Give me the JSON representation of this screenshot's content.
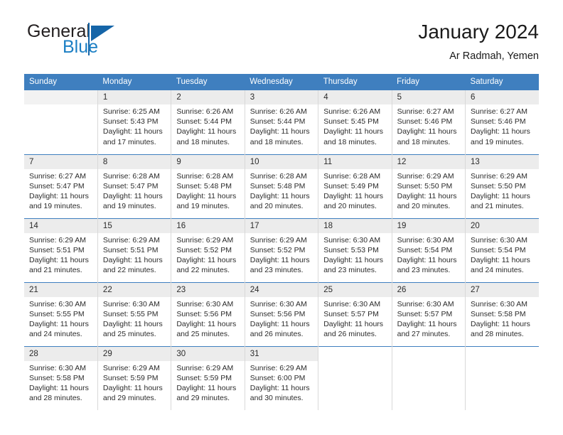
{
  "brand": {
    "name_part1": "General",
    "name_part2": "Blue",
    "logo_icon": "triangle-flag-icon"
  },
  "header": {
    "title": "January 2024",
    "location": "Ar Radmah, Yemen"
  },
  "calendar": {
    "weekday_headers": [
      "Sunday",
      "Monday",
      "Tuesday",
      "Wednesday",
      "Thursday",
      "Friday",
      "Saturday"
    ],
    "accent_color": "#3f7fbf",
    "daynum_bg": "#ececec",
    "weeks": [
      [
        {
          "day": "",
          "sunrise": "",
          "sunset": "",
          "daylight": "",
          "empty": true
        },
        {
          "day": "1",
          "sunrise": "Sunrise: 6:25 AM",
          "sunset": "Sunset: 5:43 PM",
          "daylight": "Daylight: 11 hours and 17 minutes."
        },
        {
          "day": "2",
          "sunrise": "Sunrise: 6:26 AM",
          "sunset": "Sunset: 5:44 PM",
          "daylight": "Daylight: 11 hours and 18 minutes."
        },
        {
          "day": "3",
          "sunrise": "Sunrise: 6:26 AM",
          "sunset": "Sunset: 5:44 PM",
          "daylight": "Daylight: 11 hours and 18 minutes."
        },
        {
          "day": "4",
          "sunrise": "Sunrise: 6:26 AM",
          "sunset": "Sunset: 5:45 PM",
          "daylight": "Daylight: 11 hours and 18 minutes."
        },
        {
          "day": "5",
          "sunrise": "Sunrise: 6:27 AM",
          "sunset": "Sunset: 5:46 PM",
          "daylight": "Daylight: 11 hours and 18 minutes."
        },
        {
          "day": "6",
          "sunrise": "Sunrise: 6:27 AM",
          "sunset": "Sunset: 5:46 PM",
          "daylight": "Daylight: 11 hours and 19 minutes."
        }
      ],
      [
        {
          "day": "7",
          "sunrise": "Sunrise: 6:27 AM",
          "sunset": "Sunset: 5:47 PM",
          "daylight": "Daylight: 11 hours and 19 minutes."
        },
        {
          "day": "8",
          "sunrise": "Sunrise: 6:28 AM",
          "sunset": "Sunset: 5:47 PM",
          "daylight": "Daylight: 11 hours and 19 minutes."
        },
        {
          "day": "9",
          "sunrise": "Sunrise: 6:28 AM",
          "sunset": "Sunset: 5:48 PM",
          "daylight": "Daylight: 11 hours and 19 minutes."
        },
        {
          "day": "10",
          "sunrise": "Sunrise: 6:28 AM",
          "sunset": "Sunset: 5:48 PM",
          "daylight": "Daylight: 11 hours and 20 minutes."
        },
        {
          "day": "11",
          "sunrise": "Sunrise: 6:28 AM",
          "sunset": "Sunset: 5:49 PM",
          "daylight": "Daylight: 11 hours and 20 minutes."
        },
        {
          "day": "12",
          "sunrise": "Sunrise: 6:29 AM",
          "sunset": "Sunset: 5:50 PM",
          "daylight": "Daylight: 11 hours and 20 minutes."
        },
        {
          "day": "13",
          "sunrise": "Sunrise: 6:29 AM",
          "sunset": "Sunset: 5:50 PM",
          "daylight": "Daylight: 11 hours and 21 minutes."
        }
      ],
      [
        {
          "day": "14",
          "sunrise": "Sunrise: 6:29 AM",
          "sunset": "Sunset: 5:51 PM",
          "daylight": "Daylight: 11 hours and 21 minutes."
        },
        {
          "day": "15",
          "sunrise": "Sunrise: 6:29 AM",
          "sunset": "Sunset: 5:51 PM",
          "daylight": "Daylight: 11 hours and 22 minutes."
        },
        {
          "day": "16",
          "sunrise": "Sunrise: 6:29 AM",
          "sunset": "Sunset: 5:52 PM",
          "daylight": "Daylight: 11 hours and 22 minutes."
        },
        {
          "day": "17",
          "sunrise": "Sunrise: 6:29 AM",
          "sunset": "Sunset: 5:52 PM",
          "daylight": "Daylight: 11 hours and 23 minutes."
        },
        {
          "day": "18",
          "sunrise": "Sunrise: 6:30 AM",
          "sunset": "Sunset: 5:53 PM",
          "daylight": "Daylight: 11 hours and 23 minutes."
        },
        {
          "day": "19",
          "sunrise": "Sunrise: 6:30 AM",
          "sunset": "Sunset: 5:54 PM",
          "daylight": "Daylight: 11 hours and 23 minutes."
        },
        {
          "day": "20",
          "sunrise": "Sunrise: 6:30 AM",
          "sunset": "Sunset: 5:54 PM",
          "daylight": "Daylight: 11 hours and 24 minutes."
        }
      ],
      [
        {
          "day": "21",
          "sunrise": "Sunrise: 6:30 AM",
          "sunset": "Sunset: 5:55 PM",
          "daylight": "Daylight: 11 hours and 24 minutes."
        },
        {
          "day": "22",
          "sunrise": "Sunrise: 6:30 AM",
          "sunset": "Sunset: 5:55 PM",
          "daylight": "Daylight: 11 hours and 25 minutes."
        },
        {
          "day": "23",
          "sunrise": "Sunrise: 6:30 AM",
          "sunset": "Sunset: 5:56 PM",
          "daylight": "Daylight: 11 hours and 25 minutes."
        },
        {
          "day": "24",
          "sunrise": "Sunrise: 6:30 AM",
          "sunset": "Sunset: 5:56 PM",
          "daylight": "Daylight: 11 hours and 26 minutes."
        },
        {
          "day": "25",
          "sunrise": "Sunrise: 6:30 AM",
          "sunset": "Sunset: 5:57 PM",
          "daylight": "Daylight: 11 hours and 26 minutes."
        },
        {
          "day": "26",
          "sunrise": "Sunrise: 6:30 AM",
          "sunset": "Sunset: 5:57 PM",
          "daylight": "Daylight: 11 hours and 27 minutes."
        },
        {
          "day": "27",
          "sunrise": "Sunrise: 6:30 AM",
          "sunset": "Sunset: 5:58 PM",
          "daylight": "Daylight: 11 hours and 28 minutes."
        }
      ],
      [
        {
          "day": "28",
          "sunrise": "Sunrise: 6:30 AM",
          "sunset": "Sunset: 5:58 PM",
          "daylight": "Daylight: 11 hours and 28 minutes."
        },
        {
          "day": "29",
          "sunrise": "Sunrise: 6:29 AM",
          "sunset": "Sunset: 5:59 PM",
          "daylight": "Daylight: 11 hours and 29 minutes."
        },
        {
          "day": "30",
          "sunrise": "Sunrise: 6:29 AM",
          "sunset": "Sunset: 5:59 PM",
          "daylight": "Daylight: 11 hours and 29 minutes."
        },
        {
          "day": "31",
          "sunrise": "Sunrise: 6:29 AM",
          "sunset": "Sunset: 6:00 PM",
          "daylight": "Daylight: 11 hours and 30 minutes."
        },
        {
          "day": "",
          "sunrise": "",
          "sunset": "",
          "daylight": "",
          "blank": true
        },
        {
          "day": "",
          "sunrise": "",
          "sunset": "",
          "daylight": "",
          "blank": true
        },
        {
          "day": "",
          "sunrise": "",
          "sunset": "",
          "daylight": "",
          "blank": true
        }
      ]
    ]
  }
}
